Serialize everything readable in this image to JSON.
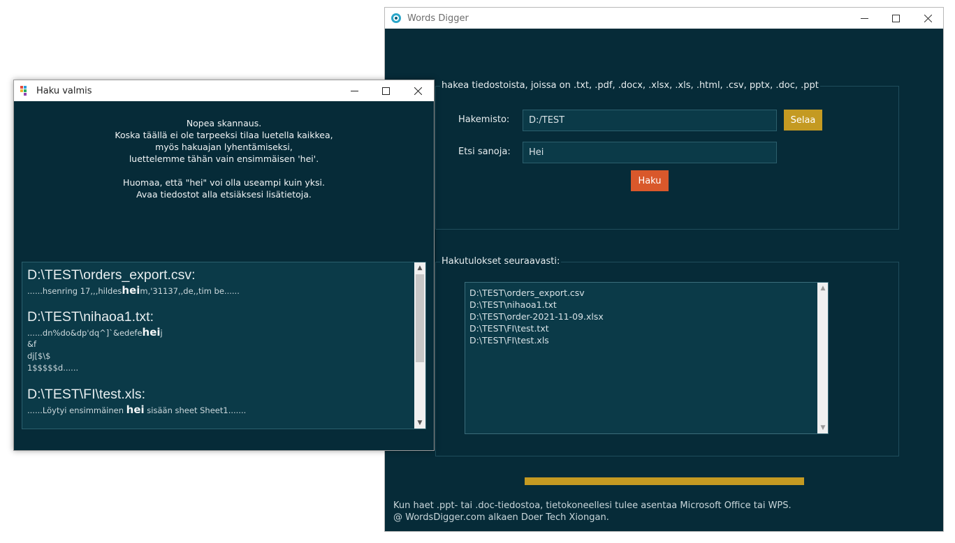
{
  "main_window": {
    "title": "Words Digger",
    "search_group": {
      "legend": "hakea tiedostoista, joissa on .txt, .pdf, .docx, .xlsx, .xls, .html, .csv, pptx, .doc, .ppt",
      "directory_label": "Hakemisto:",
      "directory_value": "D:/TEST",
      "browse_label": "Selaa",
      "words_label": "Etsi sanoja:",
      "words_value": "Hei",
      "search_label": "Haku"
    },
    "results_group": {
      "legend": "Hakutulokset seuraavasti:",
      "files": [
        "D:\\TEST\\orders_export.csv",
        "D:\\TEST\\nihaoa1.txt",
        "D:\\TEST\\order-2021-11-09.xlsx",
        "D:\\TEST\\FI\\test.txt",
        "D:\\TEST\\FI\\test.xls"
      ]
    },
    "progress": 1.0,
    "footer_line1": "Kun haet .ppt- tai .doc-tiedostoa, tietokoneellesi tulee asentaa Microsoft Office tai WPS.",
    "footer_line2": "@ WordsDigger.com alkaen Doer Tech Xiongan."
  },
  "dialog": {
    "title": "Haku valmis",
    "message_lines": [
      "Nopea skannaus.",
      "Koska täällä ei ole tarpeeksi tilaa luetella kaikkea,",
      "myös hakuajan lyhentämiseksi,",
      "luettelemme tähän vain ensimmäisen 'hei'.",
      "Huomaa, että \"hei\" voi olla useampi kuin yksi.",
      "Avaa tiedostot alla etsiäksesi lisätietoja."
    ],
    "results": [
      {
        "file": "D:\\TEST\\orders_export.csv:",
        "lines": [
          {
            "pre": "......hsenring 17,,,hildes",
            "hit": "hei",
            "post": "m,'31137,,de,,tim be......"
          }
        ]
      },
      {
        "file": "D:\\TEST\\nihaoa1.txt:",
        "lines": [
          {
            "pre": "......dn%do&dp'dq^]`&edefe",
            "hit": "hei",
            "post": "j"
          },
          {
            "pre": "&f",
            "hit": "",
            "post": ""
          },
          {
            "pre": "dj[$\\$",
            "hit": "",
            "post": ""
          },
          {
            "pre": "1$$$$$d......",
            "hit": "",
            "post": ""
          }
        ]
      },
      {
        "file": "D:\\TEST\\FI\\test.xls:",
        "lines": [
          {
            "pre": "......Löytyi ensimmäinen ",
            "hit": "hei",
            "post": " sisään sheet Sheet1......."
          }
        ]
      }
    ]
  },
  "colors": {
    "background": "#062b38",
    "field": "#0b3a48",
    "accent_gold": "#c49a22",
    "accent_orange": "#d9582b"
  }
}
